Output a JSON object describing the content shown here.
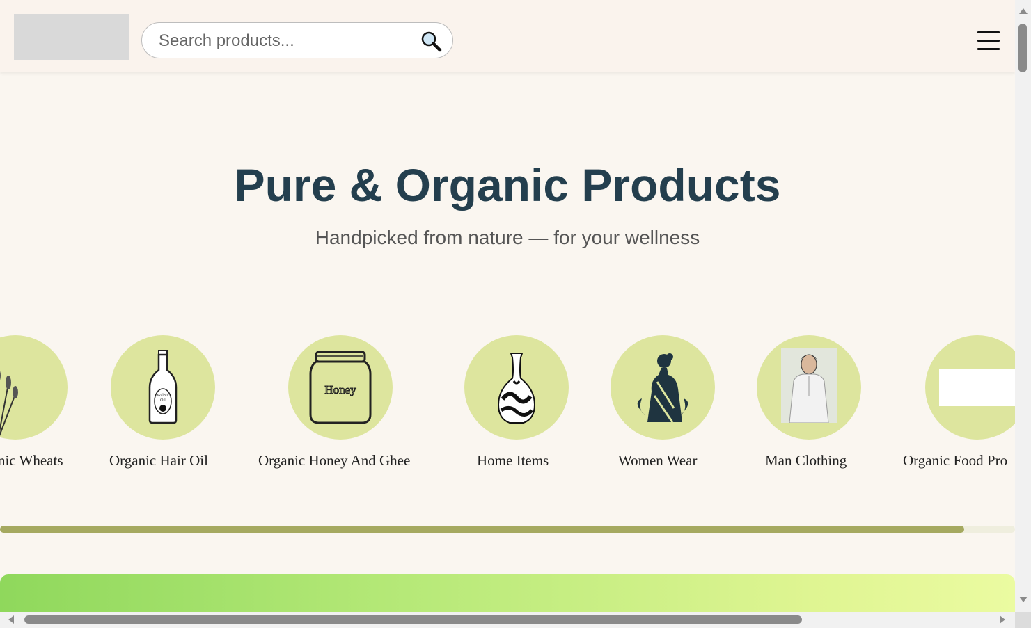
{
  "header": {
    "search_placeholder": "Search products...",
    "search_icon": "magnifier-icon",
    "menu_icon": "hamburger-menu-icon"
  },
  "hero": {
    "title": "Pure & Organic Products",
    "subtitle": "Handpicked from nature — for your wellness"
  },
  "categories": [
    {
      "label": "nic Wheats",
      "icon": "wheat-icon"
    },
    {
      "label": "Organic Hair Oil",
      "icon": "oil-bottle-icon"
    },
    {
      "label": "Organic Honey And Ghee",
      "icon": "honey-jar-icon"
    },
    {
      "label": "Home Items",
      "icon": "vase-icon"
    },
    {
      "label": "Women Wear",
      "icon": "woman-saree-icon"
    },
    {
      "label": "Man Clothing",
      "icon": "man-kurta-icon"
    },
    {
      "label": "Organic Food Pro",
      "icon": "placeholder-image-icon"
    }
  ],
  "carousel_progress_fraction": 0.95,
  "colors": {
    "title": "#243f4e",
    "circle": "#dde59e",
    "progress": "#a5a960",
    "banner_start": "#8fd85c",
    "banner_end": "#ebfba1"
  }
}
